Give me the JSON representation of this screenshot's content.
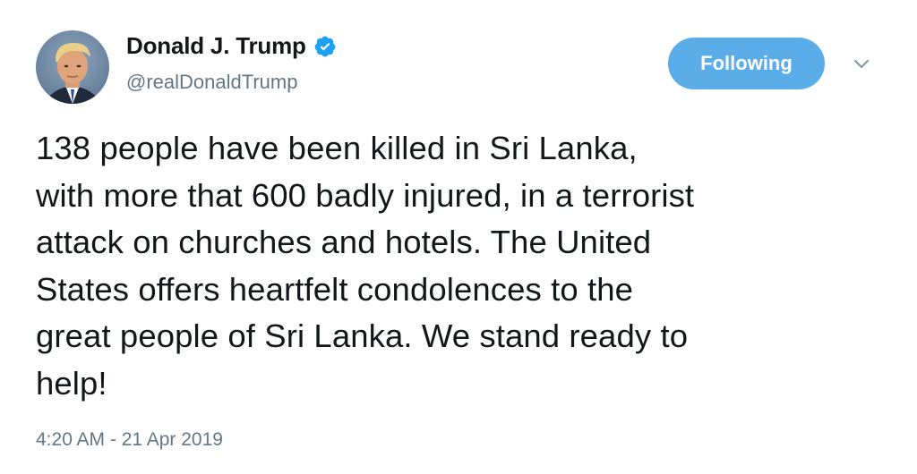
{
  "author": {
    "display_name": "Donald J. Trump",
    "handle": "@realDonaldTrump",
    "verified": true,
    "avatar_icon": "profile-photo"
  },
  "follow_button": {
    "label": "Following",
    "color": "#5aade9"
  },
  "menu_icon": "chevron-down-icon",
  "tweet": {
    "lines": [
      "138 people have been killed in Sri Lanka,",
      "with more that 600 badly injured, in a terrorist",
      "attack on churches and hotels. The United",
      "States offers heartfelt condolences to the",
      "great people of Sri Lanka. We stand ready to",
      "help!"
    ]
  },
  "timestamp": "4:20 AM - 21 Apr 2019",
  "colors": {
    "text": "#14171a",
    "secondary": "#657786",
    "verified_badge": "#1da1f2"
  }
}
